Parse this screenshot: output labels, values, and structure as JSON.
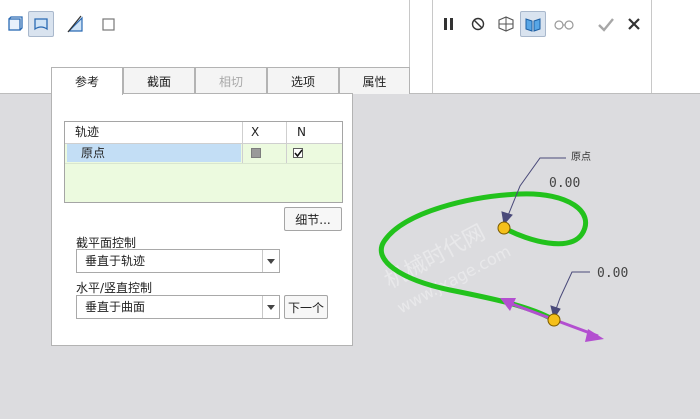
{
  "ribbon": {
    "tools_left": [
      "solid-icon",
      "surface-icon",
      "trajectory-section-icon",
      "sketch-icon"
    ],
    "tools_right": [
      "pause-icon",
      "no-preview-icon",
      "geometry-preview-icon",
      "verify-preview-icon",
      "glasses-icon",
      "confirm-icon",
      "cancel-icon"
    ]
  },
  "tabs": [
    {
      "label": "参考",
      "state": "active"
    },
    {
      "label": "截面",
      "state": "normal"
    },
    {
      "label": "相切",
      "state": "disabled"
    },
    {
      "label": "选项",
      "state": "normal"
    },
    {
      "label": "属性",
      "state": "normal"
    }
  ],
  "panel": {
    "table": {
      "headers": {
        "trajectory": "轨迹",
        "x": "X",
        "n": "N"
      },
      "rows": [
        {
          "name": "原点",
          "x": false,
          "n": true
        }
      ]
    },
    "details_button": "细节...",
    "section_plane_label": "截平面控制",
    "section_plane_value": "垂直于轨迹",
    "hv_label": "水平/竖直控制",
    "hv_value": "垂直于曲面",
    "next_button": "下一个"
  },
  "graphics": {
    "origin_label": "原点",
    "dim1": "0.00",
    "dim2": "0.00",
    "watermark_1": "机械时代网",
    "watermark_2": "www.jxage.com",
    "colors": {
      "trajectory": "#22c21c",
      "point": "#f5c01a",
      "arrow": "#b34fd0"
    }
  }
}
